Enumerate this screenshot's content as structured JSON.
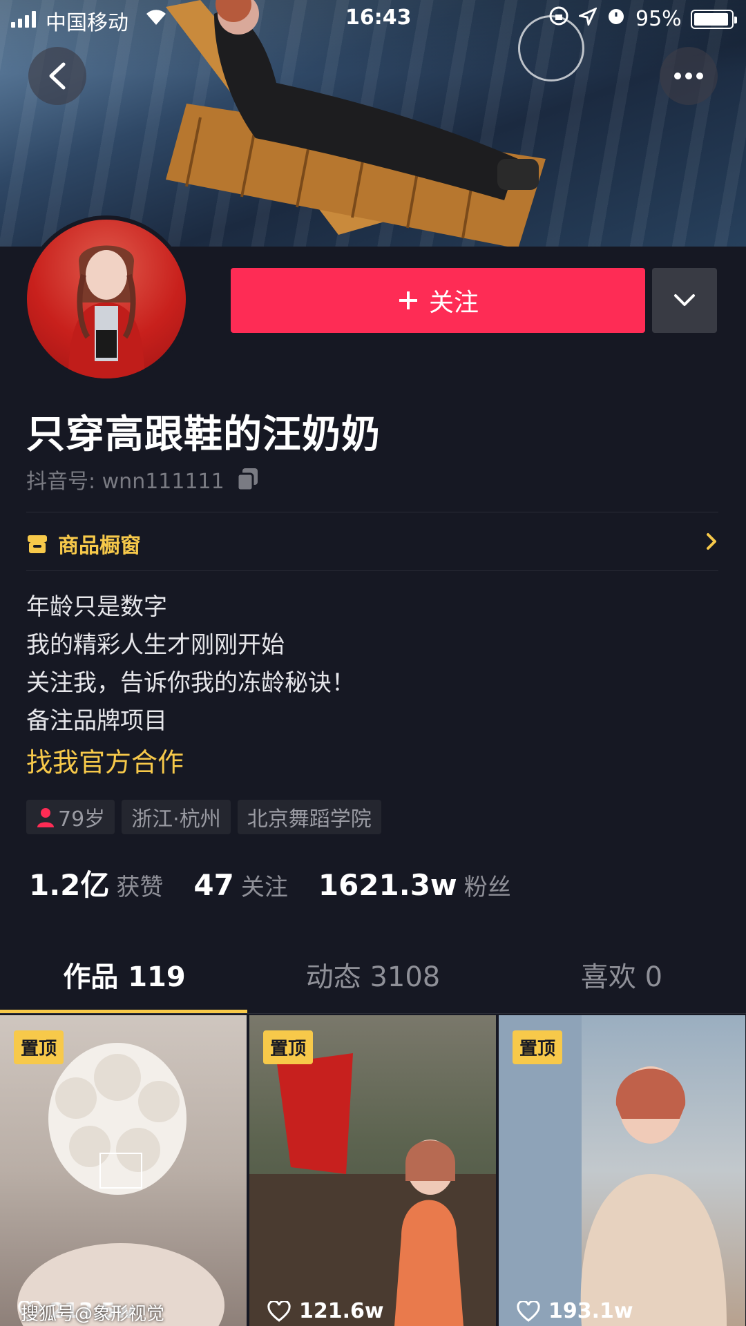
{
  "status_bar": {
    "carrier": "中国移动",
    "time": "16:43",
    "battery": "95%",
    "battery_level": 0.95
  },
  "cover": {
    "back_icon": "chevron-left-icon",
    "more_icon": "more-dots-icon"
  },
  "profile": {
    "follow_label": "关注",
    "follow_icon": "plus-icon",
    "dropdown_icon": "chevron-down-icon",
    "name": "只穿高跟鞋的汪奶奶",
    "douyin_id": "抖音号: wnn111111",
    "copy_icon": "copy-icon"
  },
  "shop": {
    "label": "商品橱窗",
    "icon": "shop-icon",
    "chevron_icon": "chevron-right-icon"
  },
  "bio": {
    "lines": [
      "年龄只是数字",
      "我的精彩人生才刚刚开始",
      "关注我，告诉你我的冻龄秘诀！",
      "备注品牌项目"
    ],
    "cooperation_link": "找我官方合作"
  },
  "tags": [
    {
      "label": "79岁",
      "icon": "female-icon"
    },
    {
      "label": "浙江·杭州"
    },
    {
      "label": "北京舞蹈学院"
    }
  ],
  "stats": [
    {
      "value": "1.2亿",
      "label": "获赞"
    },
    {
      "value": "47",
      "label": "关注"
    },
    {
      "value": "1621.3w",
      "label": "粉丝"
    }
  ],
  "tabs": [
    {
      "label": "作品 119",
      "active": true
    },
    {
      "label": "动态 3108",
      "active": false
    },
    {
      "label": "喜欢 0",
      "active": false
    }
  ],
  "videos": [
    {
      "pin": "置顶",
      "likes": "213.5w"
    },
    {
      "pin": "置顶",
      "likes": "121.6w"
    },
    {
      "pin": "置顶",
      "likes": "193.1w"
    }
  ],
  "watermark": "搜狐号@象形视觉",
  "colors": {
    "background": "#161823",
    "follow": "#fe2c55",
    "accent": "#f7c94a"
  }
}
